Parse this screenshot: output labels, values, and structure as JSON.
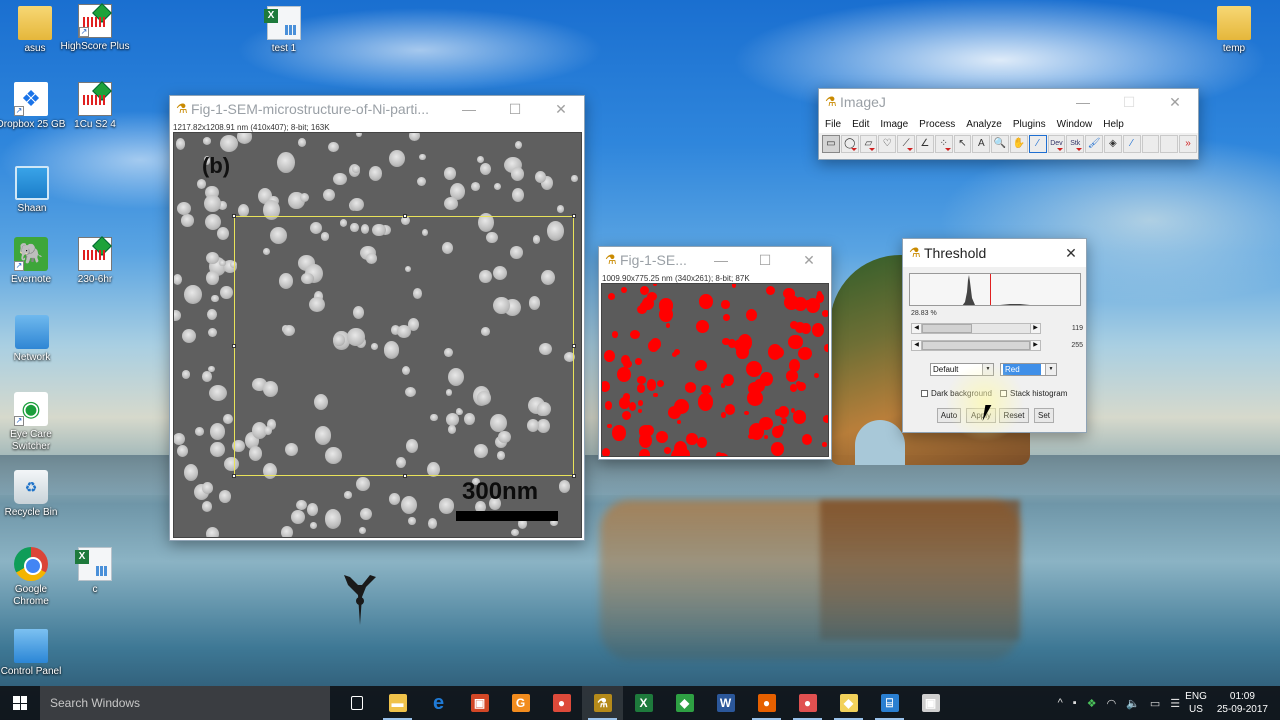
{
  "desktop": {
    "icons": [
      {
        "label": "asus",
        "icon": "user-folder-icon"
      },
      {
        "label": "HighScore Plus",
        "icon": "highscore-icon"
      },
      {
        "label": "test 1",
        "icon": "excel-file-icon"
      },
      {
        "label": "temp",
        "icon": "folder-icon"
      },
      {
        "label": "Dropbox 25 GB",
        "icon": "dropbox-icon"
      },
      {
        "label": "1Cu S2 4",
        "icon": "highscore-icon"
      },
      {
        "label": "Shaan",
        "icon": "computer-icon"
      },
      {
        "label": "Evernote",
        "icon": "evernote-icon"
      },
      {
        "label": "230-6hr",
        "icon": "highscore-icon"
      },
      {
        "label": "Network",
        "icon": "network-icon"
      },
      {
        "label": "Eye Care Switcher",
        "icon": "eye-care-icon"
      },
      {
        "label": "Recycle Bin",
        "icon": "recycle-bin-icon"
      },
      {
        "label": "Google Chrome",
        "icon": "chrome-icon"
      },
      {
        "label": "c",
        "icon": "excel-file-icon"
      },
      {
        "label": "Control Panel",
        "icon": "control-panel-icon"
      }
    ]
  },
  "sem_window": {
    "title": "Fig-1-SEM-microstructure-of-Ni-parti...",
    "info": "1217.82x1208.91 nm (410x407); 8-bit; 163K",
    "image_label": "(b)",
    "scale_label": "300nm"
  },
  "threshold_image_window": {
    "title": "Fig-1-SE...",
    "info": "1009.90x775.25 nm (340x261); 8-bit; 87K"
  },
  "imagej": {
    "title": "ImageJ",
    "menu": [
      "File",
      "Edit",
      "Image",
      "Process",
      "Analyze",
      "Plugins",
      "Window",
      "Help"
    ],
    "tools": [
      {
        "name": "rectangle-tool",
        "glyph": "▭"
      },
      {
        "name": "oval-tool",
        "glyph": "◯"
      },
      {
        "name": "polygon-tool",
        "glyph": "▱"
      },
      {
        "name": "freehand-tool",
        "glyph": "♡"
      },
      {
        "name": "line-tool",
        "glyph": "⟋"
      },
      {
        "name": "angle-tool",
        "glyph": "∠"
      },
      {
        "name": "point-tool",
        "glyph": "⁘"
      },
      {
        "name": "wand-tool",
        "glyph": "↖"
      },
      {
        "name": "text-tool",
        "glyph": "A"
      },
      {
        "name": "magnifier-tool",
        "glyph": "🔍"
      },
      {
        "name": "hand-tool",
        "glyph": "✋"
      },
      {
        "name": "color-picker-tool",
        "glyph": "⁄"
      },
      {
        "name": "dev-tool",
        "glyph": "Dev"
      },
      {
        "name": "stk-tool",
        "glyph": "Stk"
      },
      {
        "name": "brush-tool",
        "glyph": "🖌"
      },
      {
        "name": "flood-fill-tool",
        "glyph": "◈"
      },
      {
        "name": "pipette-tool",
        "glyph": "⁄"
      },
      {
        "name": "empty-slot-1",
        "glyph": ""
      },
      {
        "name": "empty-slot-2",
        "glyph": ""
      },
      {
        "name": "more-tools",
        "glyph": "»"
      }
    ]
  },
  "threshold_dialog": {
    "title": "Threshold",
    "percent": "28.83 %",
    "min_value": "119",
    "max_value": "255",
    "min_fraction": 0.467,
    "max_fraction": 1.0,
    "method": "Default",
    "display": "Red",
    "dark_background_label": "Dark background",
    "dark_background_checked": false,
    "stack_histogram_label": "Stack histogram",
    "stack_histogram_checked": false,
    "buttons": [
      "Auto",
      "Apply",
      "Reset",
      "Set"
    ]
  },
  "taskbar": {
    "search_placeholder": "Search Windows",
    "apps": [
      {
        "name": "task-view",
        "glyph": "▢",
        "color": "#222"
      },
      {
        "name": "file-explorer",
        "glyph": "▬",
        "color": "#f0c24a"
      },
      {
        "name": "edge",
        "glyph": "e",
        "color": "#1f7ad6"
      },
      {
        "name": "powerpoint-viewer",
        "glyph": "▣",
        "color": "#d24726"
      },
      {
        "name": "app-g",
        "glyph": "G",
        "color": "#f28c1e"
      },
      {
        "name": "chrome",
        "glyph": "●",
        "color": "#dd4a3a"
      },
      {
        "name": "imagej",
        "glyph": "⚗",
        "color": "#b58a1a"
      },
      {
        "name": "excel",
        "glyph": "X",
        "color": "#1e7a3c"
      },
      {
        "name": "highscore",
        "glyph": "◆",
        "color": "#2ea043"
      },
      {
        "name": "word",
        "glyph": "W",
        "color": "#2b579a"
      },
      {
        "name": "firefox",
        "glyph": "●",
        "color": "#e66000"
      },
      {
        "name": "pdf-app",
        "glyph": "●",
        "color": "#e05050"
      },
      {
        "name": "sticky-notes",
        "glyph": "◆",
        "color": "#f2d15a"
      },
      {
        "name": "fiji",
        "glyph": "⌸",
        "color": "#2a7fd1"
      },
      {
        "name": "snipping",
        "glyph": "▣",
        "color": "#cfcfcf"
      }
    ],
    "tray": {
      "language": "ENG",
      "region": "US",
      "time": "01:09",
      "date": "25-09-2017"
    }
  }
}
